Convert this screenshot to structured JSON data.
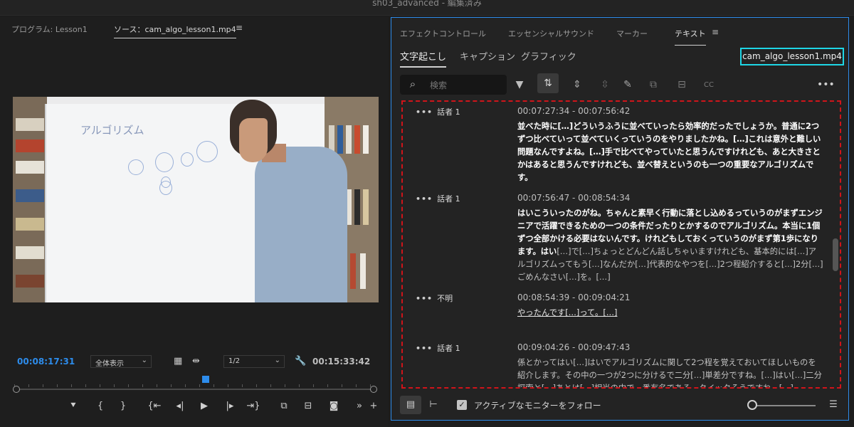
{
  "window": {
    "title": "sh03_advanced - 編集済み"
  },
  "source_monitor": {
    "tabs": [
      {
        "label": "プログラム: Lesson1"
      },
      {
        "label": "ソース：cam_algo_lesson1.mp4"
      }
    ],
    "video_writing": "アルゴリズム",
    "current_time": "00:08:17:31",
    "duration": "00:15:33:42",
    "fit_select": "全体表示",
    "resolution_select": "1/2",
    "playhead_position_fraction": 0.535
  },
  "text_panel": {
    "tabs": [
      {
        "label": "エフェクトコントロール"
      },
      {
        "label": "エッセンシャルサウンド"
      },
      {
        "label": "マーカー"
      },
      {
        "label": "テキスト"
      }
    ],
    "subtabs": [
      {
        "label": "文字起こし"
      },
      {
        "label": "キャプション"
      },
      {
        "label": "グラフィック"
      }
    ],
    "file_name": "cam_algo_lesson1.mp4",
    "search_placeholder": "検索",
    "entries": [
      {
        "speaker": "話者 1",
        "time": "00:07:27:34 - 00:07:56:42",
        "text": "並べた時に[…]どういうふうに並べていったら効率的だったでしょうか。普通に2つずつ比べていって並べていくっていうのをやりましたかね。[…]これは意外と難しい問題なんですよね。[…]手で比べてやっていたと思うんですけれども、あと大きさとかはあると思うんですけれども、並べ替えというのも一つの重要なアルゴリズムです。"
      },
      {
        "speaker": "話者 1",
        "time": "00:07:56:47 - 00:08:54:34",
        "text_bold": "はいこういったのがね。ちゃんと素早く行動に落とし込めるっていうのがまずエンジニアで活躍できるための一つの条件だったりとかするのでアルゴリズム。本当に1個ずつ全部かける必要はないんです。けれどもしておくっていうのがまず第1歩になります。はい",
        "text_dim": "[…]で[…]ちょっとどんどん話しちゃいますけれども、基本的には[…]アルゴリズムってもう[…]なんだか[…]代表的なやつを[…]2つ程紹介すると[…]2分[…]ごめんなさい[…]を。[…]"
      },
      {
        "speaker": "不明",
        "time": "00:08:54:39 - 00:09:04:21",
        "text": "やったんです[…]って。[…]"
      },
      {
        "speaker": "話者 1",
        "time": "00:09:04:26 - 00:09:47:43",
        "text": "係とかってはい[…]はいでアルゴリズムに関して2つ程を覚えておいてほしいものを紹介します。その中の一つが2つに分けるで二分[…]単差分ですね。[…]はい[…]二分探索と[…]あとは[…]相当の中で一番有名である。クイックそうですね。[…]"
      }
    ],
    "follow_label": "アクティブなモニターをフォロー",
    "follow_checked": true
  }
}
